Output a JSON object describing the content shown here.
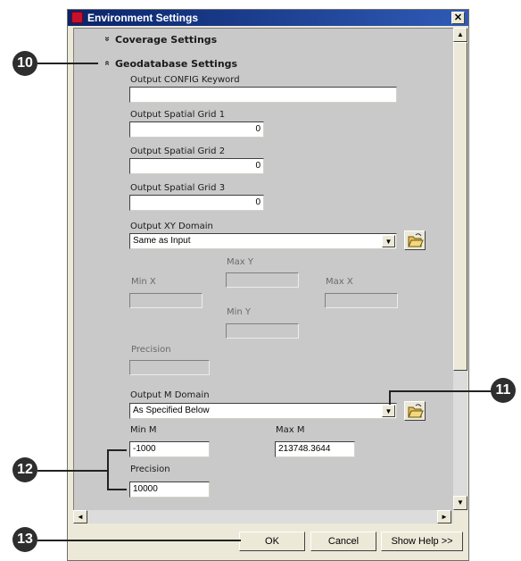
{
  "window": {
    "title": "Environment Settings",
    "close_glyph": "✕"
  },
  "sections": {
    "coverage": {
      "label": "Coverage Settings",
      "chevron": "»"
    },
    "geodatabase": {
      "label": "Geodatabase Settings",
      "chevron": "«"
    }
  },
  "fields": {
    "config_keyword": {
      "label": "Output CONFIG Keyword",
      "value": ""
    },
    "spatial_grid_1": {
      "label": "Output Spatial Grid 1",
      "value": "0"
    },
    "spatial_grid_2": {
      "label": "Output Spatial Grid 2",
      "value": "0"
    },
    "spatial_grid_3": {
      "label": "Output Spatial Grid 3",
      "value": "0"
    },
    "xy_domain": {
      "label": "Output XY Domain",
      "value": "Same as Input"
    },
    "max_y": {
      "label": "Max Y",
      "value": ""
    },
    "min_x": {
      "label": "Min X",
      "value": ""
    },
    "max_x": {
      "label": "Max X",
      "value": ""
    },
    "min_y": {
      "label": "Min Y",
      "value": ""
    },
    "xy_precision": {
      "label": "Precision",
      "value": ""
    },
    "m_domain": {
      "label": "Output M Domain",
      "value": "As Specified Below"
    },
    "min_m": {
      "label": "Min M",
      "value": "-1000"
    },
    "max_m": {
      "label": "Max M",
      "value": "213748.3644"
    },
    "m_precision": {
      "label": "Precision",
      "value": "10000"
    }
  },
  "buttons": {
    "ok": "OK",
    "cancel": "Cancel",
    "help": "Show Help >>"
  },
  "callouts": [
    "10",
    "11",
    "12",
    "13"
  ],
  "icons": {
    "dropdown": "▼",
    "scroll_up": "▲",
    "scroll_down": "▼",
    "scroll_left": "◄",
    "scroll_right": "►"
  },
  "colors": {
    "title_bar": "#0a246a",
    "content_bg": "#c9c9c9",
    "callout": "#2e2e2e"
  }
}
